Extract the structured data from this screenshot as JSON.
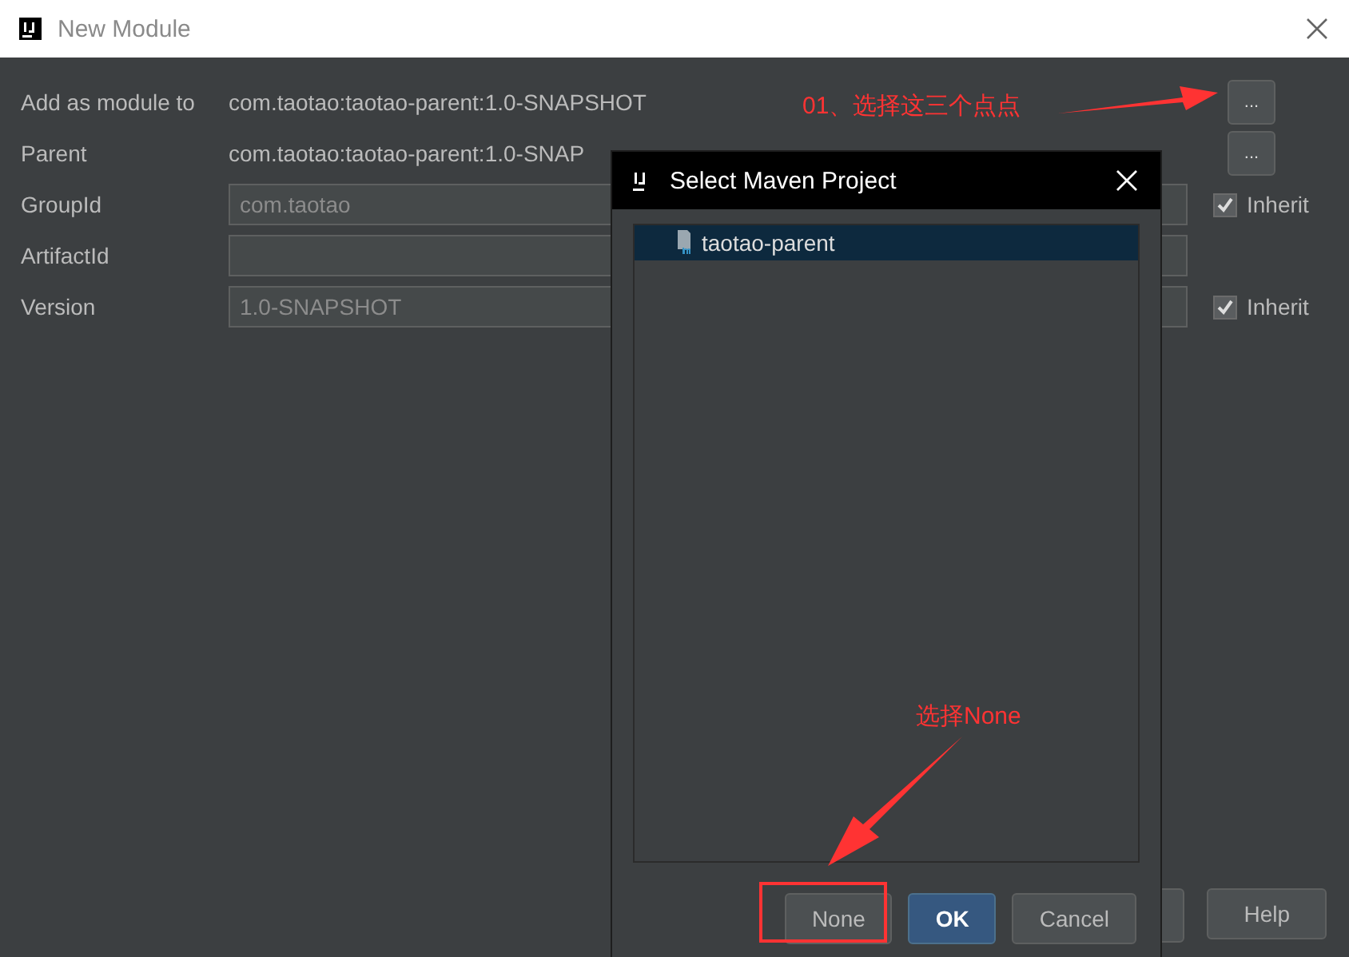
{
  "window": {
    "title": "New Module"
  },
  "rows": [
    {
      "label": "Add as module to",
      "kind": "text",
      "value": "com.taotao:taotao-parent:1.0-SNAPSHOT",
      "browse": "..."
    },
    {
      "label": "Parent",
      "kind": "text",
      "value": "com.taotao:taotao-parent:1.0-SNAP",
      "browse": "..."
    },
    {
      "label": "GroupId",
      "kind": "field",
      "value": "com.taotao",
      "inherit": {
        "label": "Inherit",
        "checked": true
      }
    },
    {
      "label": "ArtifactId",
      "kind": "field",
      "value": ""
    },
    {
      "label": "Version",
      "kind": "field",
      "value": "1.0-SNAPSHOT",
      "inherit": {
        "label": "Inherit",
        "checked": true
      }
    }
  ],
  "footer_buttons": [
    "Help"
  ],
  "dialog": {
    "title": "Select Maven Project",
    "items": [
      {
        "label": "taotao-parent",
        "selected": true
      }
    ],
    "buttons": [
      {
        "label": "None",
        "default": false
      },
      {
        "label": "OK",
        "default": true
      },
      {
        "label": "Cancel",
        "default": false
      }
    ]
  },
  "annotations": [
    "01、选择这三个点点",
    "选择None"
  ]
}
